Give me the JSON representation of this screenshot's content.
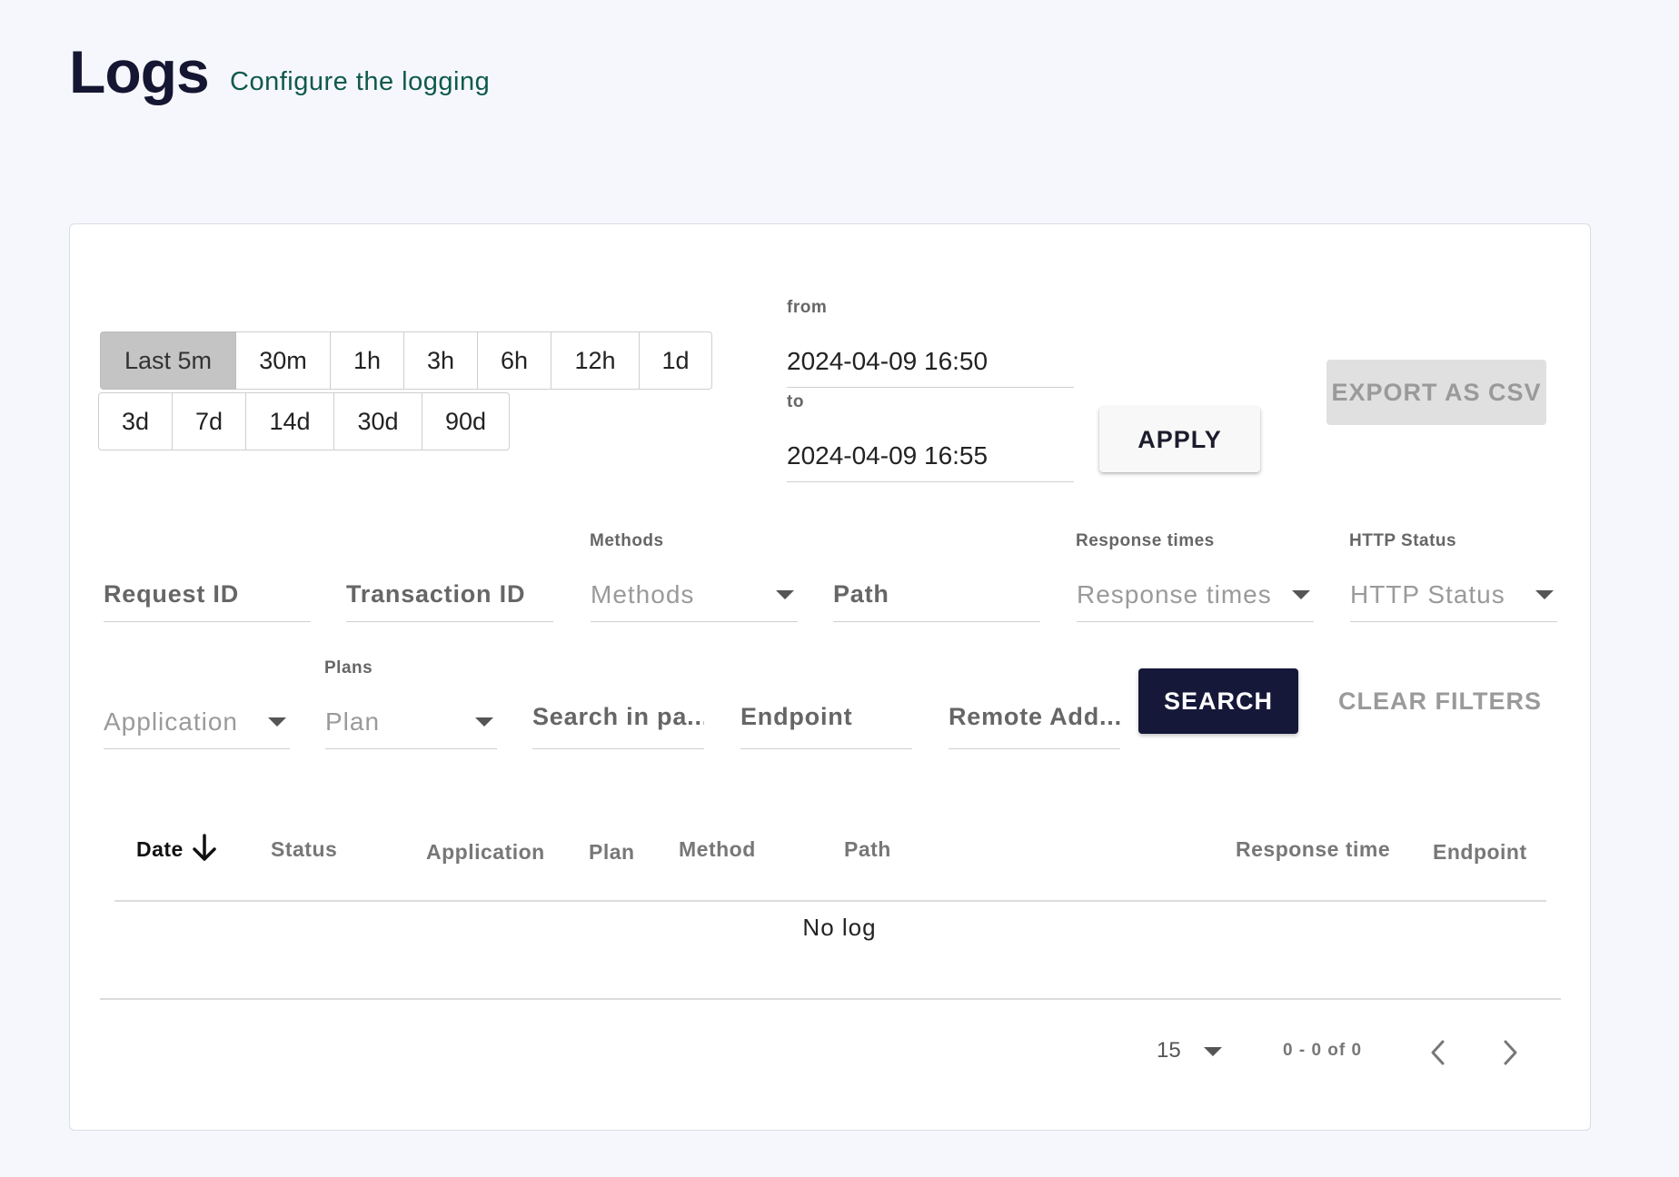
{
  "header": {
    "title": "Logs",
    "subtitle": "Configure the logging"
  },
  "time_ranges": {
    "row1": [
      "Last 5m",
      "30m",
      "1h",
      "3h",
      "6h",
      "12h",
      "1d"
    ],
    "row2": [
      "3d",
      "7d",
      "14d",
      "30d",
      "90d"
    ],
    "active": "Last 5m"
  },
  "date_range": {
    "from_label": "from",
    "from_value": "2024-04-09 16:50",
    "to_label": "to",
    "to_value": "2024-04-09 16:55",
    "apply_label": "APPLY",
    "export_label": "EXPORT AS CSV"
  },
  "filters": {
    "request_id": "Request ID",
    "transaction_id": "Transaction ID",
    "methods_label": "Methods",
    "methods_placeholder": "Methods",
    "path": "Path",
    "response_times_label": "Response times",
    "response_times_placeholder": "Response times",
    "http_status_label": "HTTP Status",
    "http_status_placeholder": "HTTP Status",
    "application_placeholder": "Application",
    "plans_label": "Plans",
    "plan_placeholder": "Plan",
    "search_payload": "Search in pa...",
    "endpoint": "Endpoint",
    "remote_address": "Remote Add...",
    "search_label": "SEARCH",
    "clear_label": "CLEAR FILTERS"
  },
  "table": {
    "columns": [
      "Date",
      "Status",
      "Application",
      "Plan",
      "Method",
      "Path",
      "Response time",
      "Endpoint"
    ],
    "sorted_column": "Date",
    "sort_direction": "descending",
    "empty_text": "No log"
  },
  "pagination": {
    "page_size": "15",
    "range_text": "0 - 0 of 0"
  }
}
